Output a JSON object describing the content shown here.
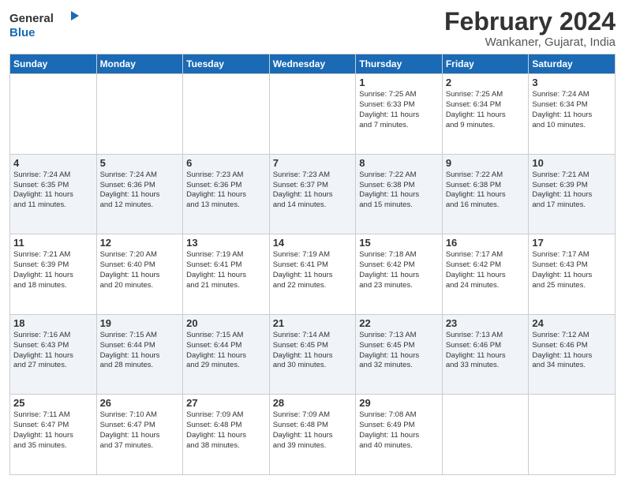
{
  "logo": {
    "general": "General",
    "blue": "Blue"
  },
  "header": {
    "title": "February 2024",
    "subtitle": "Wankaner, Gujarat, India"
  },
  "days_of_week": [
    "Sunday",
    "Monday",
    "Tuesday",
    "Wednesday",
    "Thursday",
    "Friday",
    "Saturday"
  ],
  "weeks": [
    [
      {
        "day": "",
        "info": ""
      },
      {
        "day": "",
        "info": ""
      },
      {
        "day": "",
        "info": ""
      },
      {
        "day": "",
        "info": ""
      },
      {
        "day": "1",
        "info": "Sunrise: 7:25 AM\nSunset: 6:33 PM\nDaylight: 11 hours\nand 7 minutes."
      },
      {
        "day": "2",
        "info": "Sunrise: 7:25 AM\nSunset: 6:34 PM\nDaylight: 11 hours\nand 9 minutes."
      },
      {
        "day": "3",
        "info": "Sunrise: 7:24 AM\nSunset: 6:34 PM\nDaylight: 11 hours\nand 10 minutes."
      }
    ],
    [
      {
        "day": "4",
        "info": "Sunrise: 7:24 AM\nSunset: 6:35 PM\nDaylight: 11 hours\nand 11 minutes."
      },
      {
        "day": "5",
        "info": "Sunrise: 7:24 AM\nSunset: 6:36 PM\nDaylight: 11 hours\nand 12 minutes."
      },
      {
        "day": "6",
        "info": "Sunrise: 7:23 AM\nSunset: 6:36 PM\nDaylight: 11 hours\nand 13 minutes."
      },
      {
        "day": "7",
        "info": "Sunrise: 7:23 AM\nSunset: 6:37 PM\nDaylight: 11 hours\nand 14 minutes."
      },
      {
        "day": "8",
        "info": "Sunrise: 7:22 AM\nSunset: 6:38 PM\nDaylight: 11 hours\nand 15 minutes."
      },
      {
        "day": "9",
        "info": "Sunrise: 7:22 AM\nSunset: 6:38 PM\nDaylight: 11 hours\nand 16 minutes."
      },
      {
        "day": "10",
        "info": "Sunrise: 7:21 AM\nSunset: 6:39 PM\nDaylight: 11 hours\nand 17 minutes."
      }
    ],
    [
      {
        "day": "11",
        "info": "Sunrise: 7:21 AM\nSunset: 6:39 PM\nDaylight: 11 hours\nand 18 minutes."
      },
      {
        "day": "12",
        "info": "Sunrise: 7:20 AM\nSunset: 6:40 PM\nDaylight: 11 hours\nand 20 minutes."
      },
      {
        "day": "13",
        "info": "Sunrise: 7:19 AM\nSunset: 6:41 PM\nDaylight: 11 hours\nand 21 minutes."
      },
      {
        "day": "14",
        "info": "Sunrise: 7:19 AM\nSunset: 6:41 PM\nDaylight: 11 hours\nand 22 minutes."
      },
      {
        "day": "15",
        "info": "Sunrise: 7:18 AM\nSunset: 6:42 PM\nDaylight: 11 hours\nand 23 minutes."
      },
      {
        "day": "16",
        "info": "Sunrise: 7:17 AM\nSunset: 6:42 PM\nDaylight: 11 hours\nand 24 minutes."
      },
      {
        "day": "17",
        "info": "Sunrise: 7:17 AM\nSunset: 6:43 PM\nDaylight: 11 hours\nand 25 minutes."
      }
    ],
    [
      {
        "day": "18",
        "info": "Sunrise: 7:16 AM\nSunset: 6:43 PM\nDaylight: 11 hours\nand 27 minutes."
      },
      {
        "day": "19",
        "info": "Sunrise: 7:15 AM\nSunset: 6:44 PM\nDaylight: 11 hours\nand 28 minutes."
      },
      {
        "day": "20",
        "info": "Sunrise: 7:15 AM\nSunset: 6:44 PM\nDaylight: 11 hours\nand 29 minutes."
      },
      {
        "day": "21",
        "info": "Sunrise: 7:14 AM\nSunset: 6:45 PM\nDaylight: 11 hours\nand 30 minutes."
      },
      {
        "day": "22",
        "info": "Sunrise: 7:13 AM\nSunset: 6:45 PM\nDaylight: 11 hours\nand 32 minutes."
      },
      {
        "day": "23",
        "info": "Sunrise: 7:13 AM\nSunset: 6:46 PM\nDaylight: 11 hours\nand 33 minutes."
      },
      {
        "day": "24",
        "info": "Sunrise: 7:12 AM\nSunset: 6:46 PM\nDaylight: 11 hours\nand 34 minutes."
      }
    ],
    [
      {
        "day": "25",
        "info": "Sunrise: 7:11 AM\nSunset: 6:47 PM\nDaylight: 11 hours\nand 35 minutes."
      },
      {
        "day": "26",
        "info": "Sunrise: 7:10 AM\nSunset: 6:47 PM\nDaylight: 11 hours\nand 37 minutes."
      },
      {
        "day": "27",
        "info": "Sunrise: 7:09 AM\nSunset: 6:48 PM\nDaylight: 11 hours\nand 38 minutes."
      },
      {
        "day": "28",
        "info": "Sunrise: 7:09 AM\nSunset: 6:48 PM\nDaylight: 11 hours\nand 39 minutes."
      },
      {
        "day": "29",
        "info": "Sunrise: 7:08 AM\nSunset: 6:49 PM\nDaylight: 11 hours\nand 40 minutes."
      },
      {
        "day": "",
        "info": ""
      },
      {
        "day": "",
        "info": ""
      }
    ]
  ]
}
